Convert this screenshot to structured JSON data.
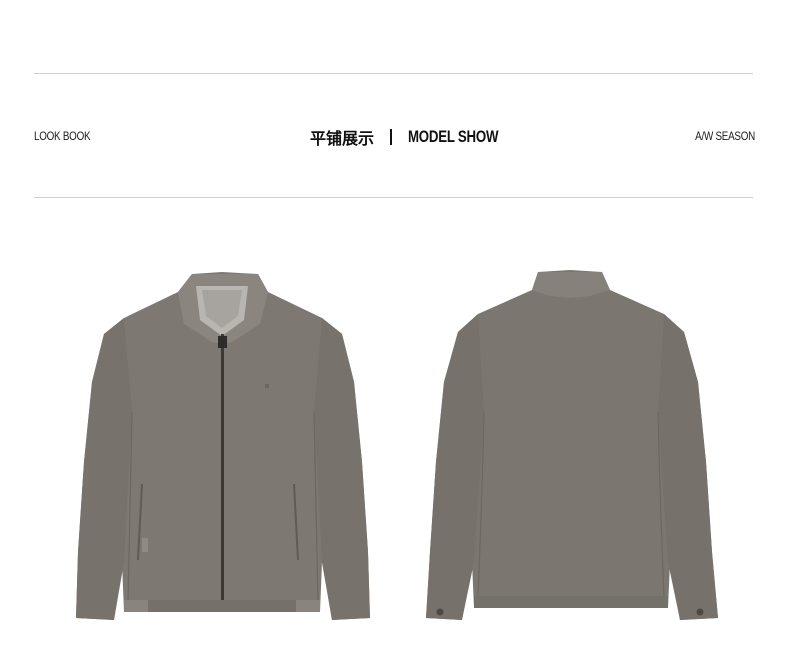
{
  "header": {
    "left_label": "LOOK BOOK",
    "title_cn": "平铺展示",
    "title_en": "MODEL SHOW",
    "right_label": "A/W SEASON"
  },
  "colors": {
    "jacket": "#7d7872",
    "jacket_shadow": "#6b6762",
    "jacket_light": "#8c8781",
    "rule": "#cfcfcf",
    "text": "#111111"
  },
  "images": {
    "front": "jacket-front-photo",
    "back": "jacket-back-photo"
  }
}
